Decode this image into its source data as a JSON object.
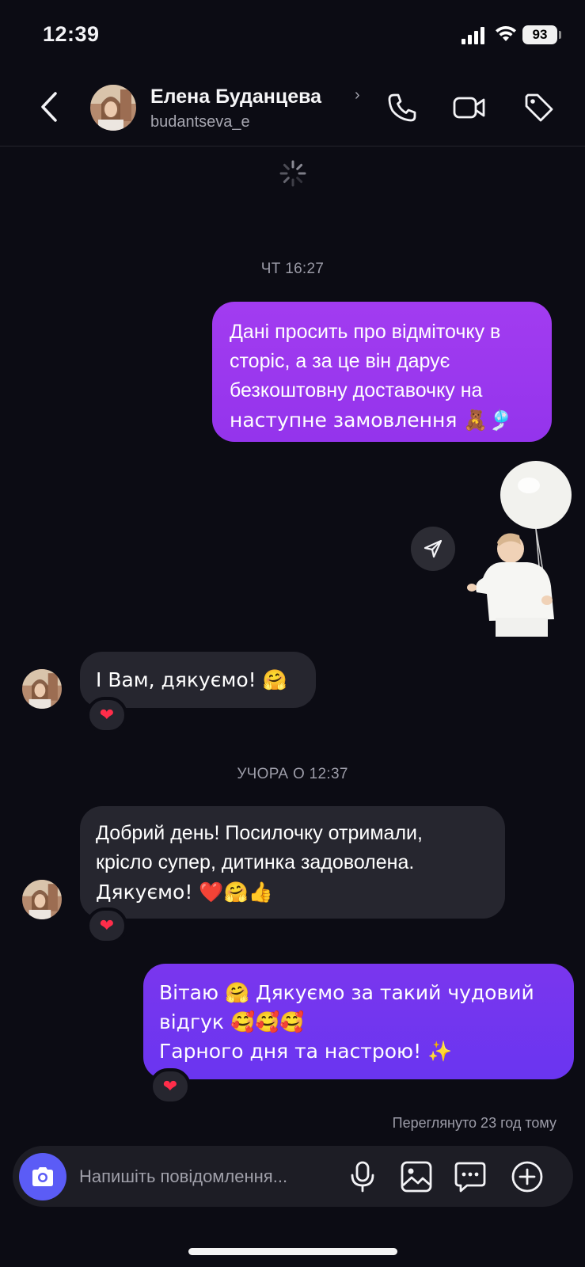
{
  "status_bar": {
    "time": "12:39",
    "battery": "93"
  },
  "header": {
    "contact_name": "Елена Буданцева",
    "contact_handle": "budantseva_e"
  },
  "chat": {
    "timestamp_1": "ЧТ 16:27",
    "timestamp_2": "УЧОРА О 12:37",
    "messages": [
      {
        "direction": "out",
        "lines": [
          "Дані просить про відміточку в",
          "сторіс, а за це він дарує",
          "безкоштовну доставочку на",
          "наступне замовлення 🧸🎐"
        ]
      },
      {
        "direction": "in",
        "lines": [
          "І Вам, дякуємо! 🤗"
        ],
        "reaction": "❤"
      },
      {
        "direction": "in",
        "lines": [
          "Добрий день! Посилочку отримали,",
          "крісло супер, дитинка задоволена.",
          "Дякуємо! ❤️🤗👍"
        ],
        "reaction": "❤"
      },
      {
        "direction": "out",
        "lines": [
          "Вітаю 🤗 Дякуємо за такий чудовий",
          "відгук 🥰🥰🥰",
          "Гарного дня та настрою! ✨"
        ],
        "reaction": "❤"
      }
    ],
    "seen_status": "Переглянуто 23 год тому"
  },
  "composer": {
    "placeholder": "Напишіть повідомлення..."
  },
  "colors": {
    "background": "#0c0c14",
    "outgoing_bubble_1": "#9a38ee",
    "outgoing_bubble_2": "#7035ef",
    "incoming_bubble": "#26262f",
    "camera_button": "#5b5cf6",
    "reaction_heart": "#ff2d4a"
  },
  "icons": {
    "header": [
      "back-icon",
      "phone-icon",
      "video-icon",
      "tag-icon"
    ],
    "composer": [
      "camera-icon",
      "microphone-icon",
      "gallery-icon",
      "sticker-icon",
      "plus-icon"
    ]
  }
}
